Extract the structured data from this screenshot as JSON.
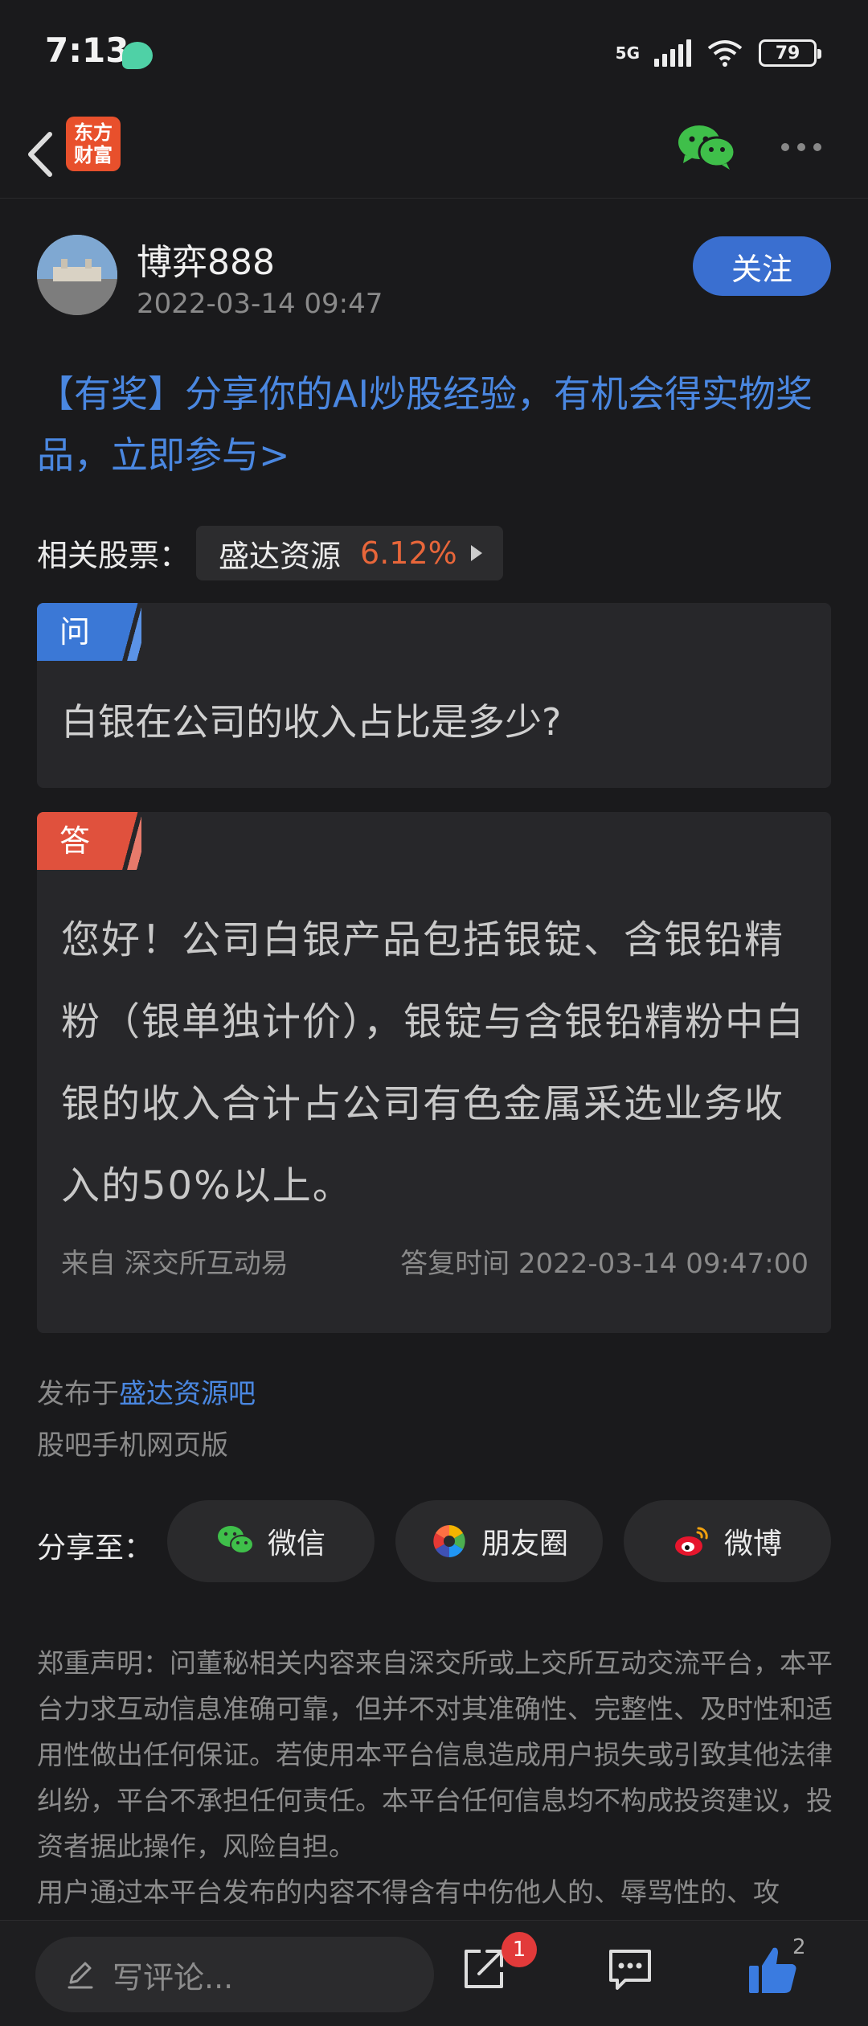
{
  "status_bar": {
    "time": "7:13",
    "network": "5G",
    "battery": "79"
  },
  "nav": {
    "logo_line1": "东方",
    "logo_line2": "财富"
  },
  "author": {
    "name": "博弈888",
    "time": "2022-03-14 09:47",
    "follow_label": "关注"
  },
  "promo": "【有奖】分享你的AI炒股经验，有机会得实物奖品，立即参与>",
  "related": {
    "label": "相关股票：",
    "stock_name": "盛达资源",
    "stock_change": "6.12%"
  },
  "question": {
    "tag": "问",
    "text": "白银在公司的收入占比是多少?"
  },
  "answer": {
    "tag": "答",
    "text": "您好！公司白银产品包括银锭、含银铅精粉（银单独计价），银锭与含银铅精粉中白银的收入合计占公司有色金属采选业务收入的50%以上。",
    "source": "来自 深交所互动易",
    "reply_time": "答复时间 2022-03-14 09:47:00"
  },
  "published": {
    "prefix": "发布于",
    "bar_name": "盛达资源吧",
    "channel": "股吧手机网页版"
  },
  "share": {
    "label": "分享至：",
    "wechat": "微信",
    "moments": "朋友圈",
    "weibo": "微博"
  },
  "disclaimer": "郑重声明：问董秘相关内容来自深交所或上交所互动交流平台，本平台力求互动信息准确可靠，但并不对其准确性、完整性、及时性和适用性做出任何保证。若使用本平台信息造成用户损失或引致其他法律纠纷，平台不承担任何责任。本平台任何信息均不构成投资建议，投资者据此操作，风险自担。\n用户通过本平台发布的内容不得含有中伤他人的、辱骂性的、攻",
  "bottom_bar": {
    "comment_placeholder": "写评论...",
    "share_badge": "1",
    "like_count": "2"
  },
  "colors": {
    "accent_blue": "#3a6fd0",
    "link_blue": "#4a87e0",
    "stock_up": "#e8663a",
    "answer_red": "#e0513d"
  }
}
